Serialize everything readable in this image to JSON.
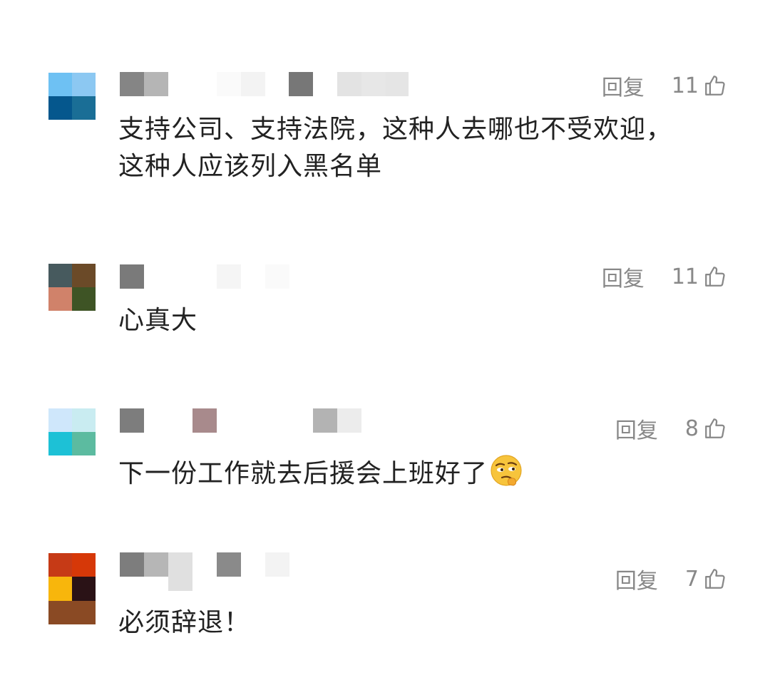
{
  "comments": [
    {
      "reply_label": "回复",
      "likes": "11",
      "text": "支持公司、支持法院，这种人去哪也不受欢迎，这种人应该列入黑名单",
      "avatar_colors": [
        "#6ec1f3",
        "#8cc8f2",
        "#05578d",
        "#1a6e96"
      ]
    },
    {
      "reply_label": "回复",
      "likes": "11",
      "text": "心真大",
      "avatar_colors": [
        "#475a5e",
        "#6b4a28",
        "#d0826a",
        "#3e5425"
      ]
    },
    {
      "reply_label": "回复",
      "likes": "8",
      "text": "下一份工作就去后援会上班好了",
      "avatar_colors": [
        "#cfe7fb",
        "#c9ecf1",
        "#1dc1d6",
        "#5cbba0"
      ],
      "emoji": "smirk-emoji"
    },
    {
      "reply_label": "回复",
      "likes": "7",
      "text": "必须辞退！",
      "avatar_colors": [
        "#c63a16",
        "#d63808",
        "#f8b60c",
        "#2a1216",
        "#8a4a24",
        "#8a4a24"
      ]
    }
  ]
}
